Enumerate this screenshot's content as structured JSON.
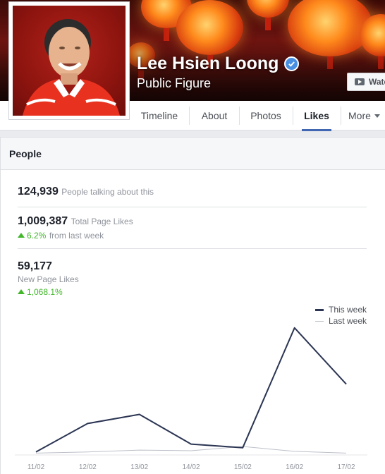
{
  "page": {
    "name": "Lee Hsien Loong",
    "category": "Public Figure",
    "watch_label": "Wate"
  },
  "tabs": [
    {
      "label": "Timeline",
      "active": false
    },
    {
      "label": "About",
      "active": false
    },
    {
      "label": "Photos",
      "active": false
    },
    {
      "label": "Likes",
      "active": true
    },
    {
      "label": "More",
      "active": false
    }
  ],
  "people": {
    "section_title": "People",
    "talking": {
      "value": "124,939",
      "label": "People talking about this"
    },
    "total_likes": {
      "value": "1,009,387",
      "label": "Total Page Likes",
      "change": "6.2%",
      "change_suffix": "from last week"
    },
    "new_likes": {
      "value": "59,177",
      "label": "New Page Likes",
      "change": "1,068.1%"
    }
  },
  "colors": {
    "this_week": "#2b3553",
    "last_week": "#bcc0c8",
    "accent": "#4267b2",
    "up": "#42b72a"
  },
  "chart_data": {
    "type": "line",
    "x": [
      "11/02",
      "12/02",
      "13/02",
      "14/02",
      "15/02",
      "16/02",
      "17/02"
    ],
    "series": [
      {
        "name": "This week",
        "values": [
          500,
          5200,
          6700,
          1800,
          1200,
          21000,
          11700
        ]
      },
      {
        "name": "Last week",
        "values": [
          300,
          500,
          800,
          700,
          1400,
          600,
          300
        ]
      }
    ],
    "ylim": [
      0,
      24000
    ],
    "legend": "top-right",
    "grid": false
  }
}
